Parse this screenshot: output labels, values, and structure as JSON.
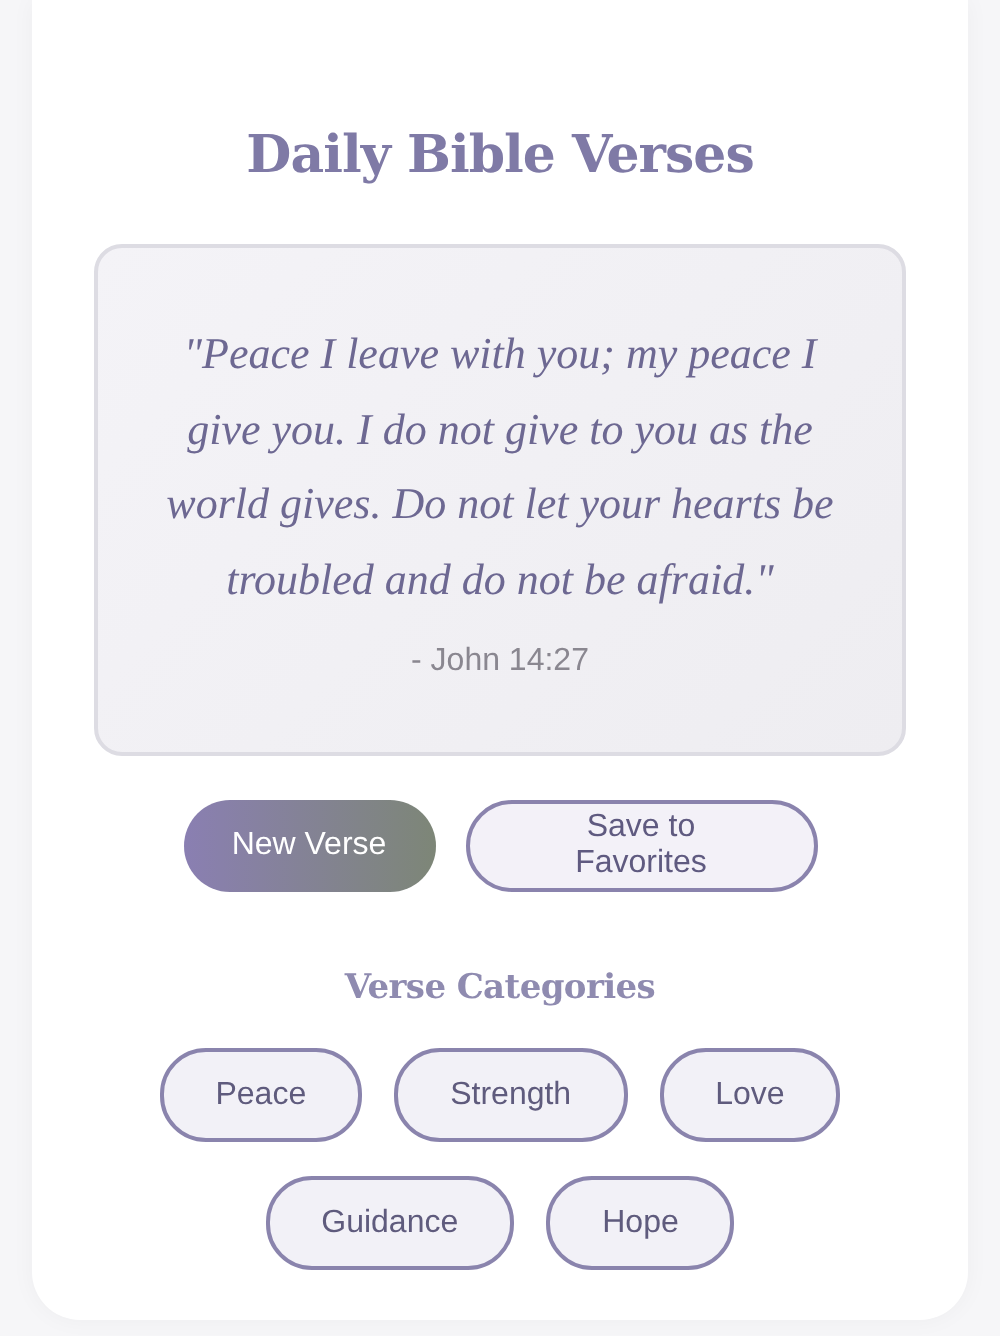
{
  "title": "Daily Bible Verses",
  "verse": {
    "text": "\"Peace I leave with you; my peace I give you. I do not give to you as the world gives. Do not let your hearts be troubled and do not be afraid.\"",
    "reference": "- John 14:27"
  },
  "actions": [
    {
      "label": "New Verse",
      "kind": "primary"
    },
    {
      "label": "Save to Favorites",
      "kind": "secondary"
    }
  ],
  "categories": {
    "heading": "Verse Categories",
    "items": [
      "Peace",
      "Strength",
      "Love",
      "Guidance",
      "Hope"
    ]
  }
}
